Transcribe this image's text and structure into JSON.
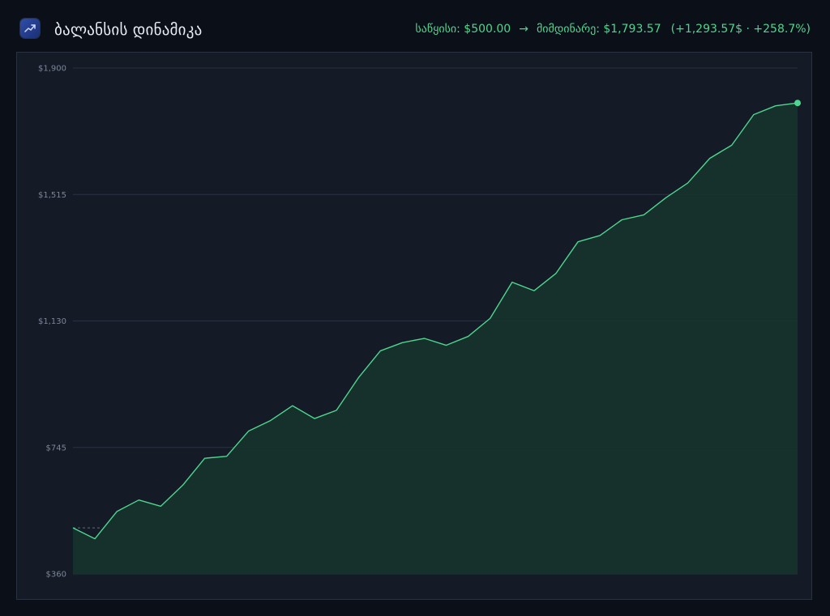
{
  "header": {
    "title": "ბალანსის დინამიკა",
    "start_label": "საწყისი: $500.00",
    "arrow": "→",
    "current_label": "მიმდინარე: $1,793.57",
    "change_label": "(+1,293.57$ · +258.7%)",
    "icon": "trending-up-icon"
  },
  "colors": {
    "background": "#0b0f17",
    "panel": "#141a26",
    "line": "#4ed68f",
    "area": "#16332c",
    "grid": "#2a3140",
    "tick": "#7c8699"
  },
  "chart_data": {
    "type": "area",
    "title": "",
    "xlabel": "",
    "ylabel": "",
    "ylim": [
      360,
      1900
    ],
    "yticks": [
      360,
      745,
      1130,
      1515,
      1900
    ],
    "ytick_labels": [
      "$360",
      "$745",
      "$1,130",
      "$1,515",
      "$1,900"
    ],
    "baseline": 500,
    "grid": true,
    "x": [
      0,
      1,
      2,
      3,
      4,
      5,
      6,
      7,
      8,
      9,
      10,
      11,
      12,
      13,
      14,
      15,
      16,
      17,
      18,
      19,
      20,
      21,
      22,
      23,
      24,
      25,
      26,
      27,
      28,
      29,
      30,
      31,
      32,
      33
    ],
    "values": [
      500,
      467,
      550,
      585,
      566,
      630,
      712,
      718,
      795,
      827,
      872,
      833,
      858,
      957,
      1039,
      1064,
      1077,
      1056,
      1083,
      1138,
      1248,
      1222,
      1275,
      1371,
      1390,
      1438,
      1453,
      1505,
      1550,
      1625,
      1665,
      1758,
      1785,
      1793.57
    ],
    "final_point": 1793.57
  }
}
